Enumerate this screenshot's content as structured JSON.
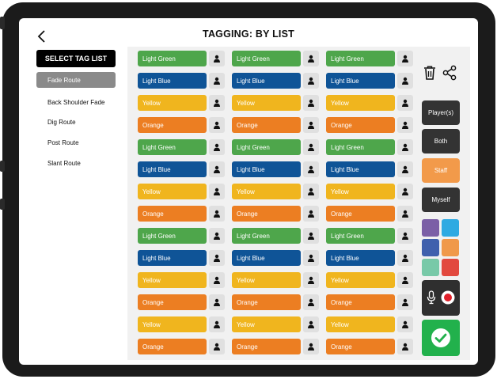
{
  "header": {
    "title": "TAGGING: BY LIST"
  },
  "tag_list": {
    "select_label": "SELECT TAG LIST",
    "items": [
      "Fade Route",
      "Back Shoulder Fade",
      "Dig Route",
      "Post Route",
      "Slant Route"
    ],
    "active_index": 0
  },
  "tag_rows": [
    "Light Green",
    "Light Blue",
    "Yellow",
    "Orange",
    "Light Green",
    "Light Blue",
    "Yellow",
    "Orange",
    "Light Green",
    "Light Blue",
    "Yellow",
    "Orange",
    "Yellow",
    "Orange"
  ],
  "tag_colors": {
    "Light Green": "#4ea64b",
    "Light Blue": "#0f5497",
    "Yellow": "#f0b51e",
    "Orange": "#ec7e22"
  },
  "side_buttons": [
    {
      "label": "Player(s)",
      "color": "#333333"
    },
    {
      "label": "Both",
      "color": "#333333"
    },
    {
      "label": "Staff",
      "color": "#f29a4a"
    },
    {
      "label": "Myself",
      "color": "#333333"
    }
  ],
  "swatches": [
    "#7b5fa6",
    "#2eaae2",
    "#3f60ad",
    "#f0994a",
    "#78c9a8",
    "#e2493f"
  ],
  "icons": {
    "back": "chevron-left-icon",
    "delete": "trash-icon",
    "share": "share-icon",
    "person": "person-icon",
    "mic": "microphone-icon",
    "record": "record-icon",
    "confirm": "checkmark-icon"
  },
  "colors": {
    "confirm": "#22b14c",
    "record": "#e0202a"
  }
}
